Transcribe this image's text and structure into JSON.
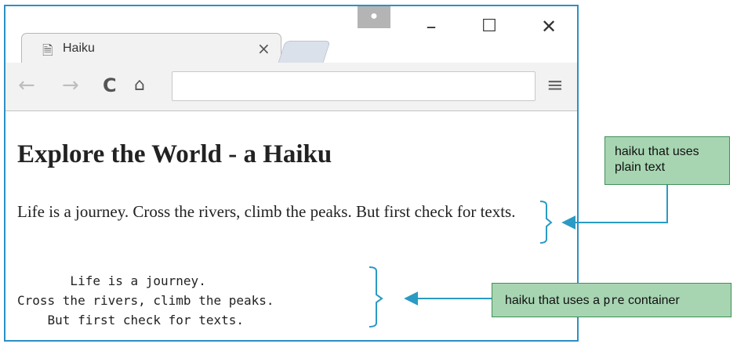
{
  "browser": {
    "tab_title": "Haiku",
    "tab_close_glyph": "×",
    "address_value": "",
    "icons": {
      "page": "page-icon",
      "back": "back-arrow-icon",
      "forward": "forward-arrow-icon",
      "reload": "reload-icon",
      "home": "home-icon",
      "menu": "menu-icon",
      "profile": "profile-icon"
    }
  },
  "page": {
    "heading": "Explore the World - a Haiku",
    "paragraph": "Life is a journey. Cross the rivers, climb the peaks. But first check for texts.",
    "pre_text": "       Life is a journey.\nCross the rivers, climb the peaks.\n    But first check for texts."
  },
  "annotations": {
    "plain_text_callout": "haiku that uses plain text",
    "pre_callout_prefix": "haiku that uses a ",
    "pre_callout_code": "pre",
    "pre_callout_suffix": " container"
  },
  "colors": {
    "window_border": "#2e8fc4",
    "callout_fill": "#a7d5b2",
    "callout_border": "#3f9158",
    "annotation_line": "#2a9bc4"
  }
}
